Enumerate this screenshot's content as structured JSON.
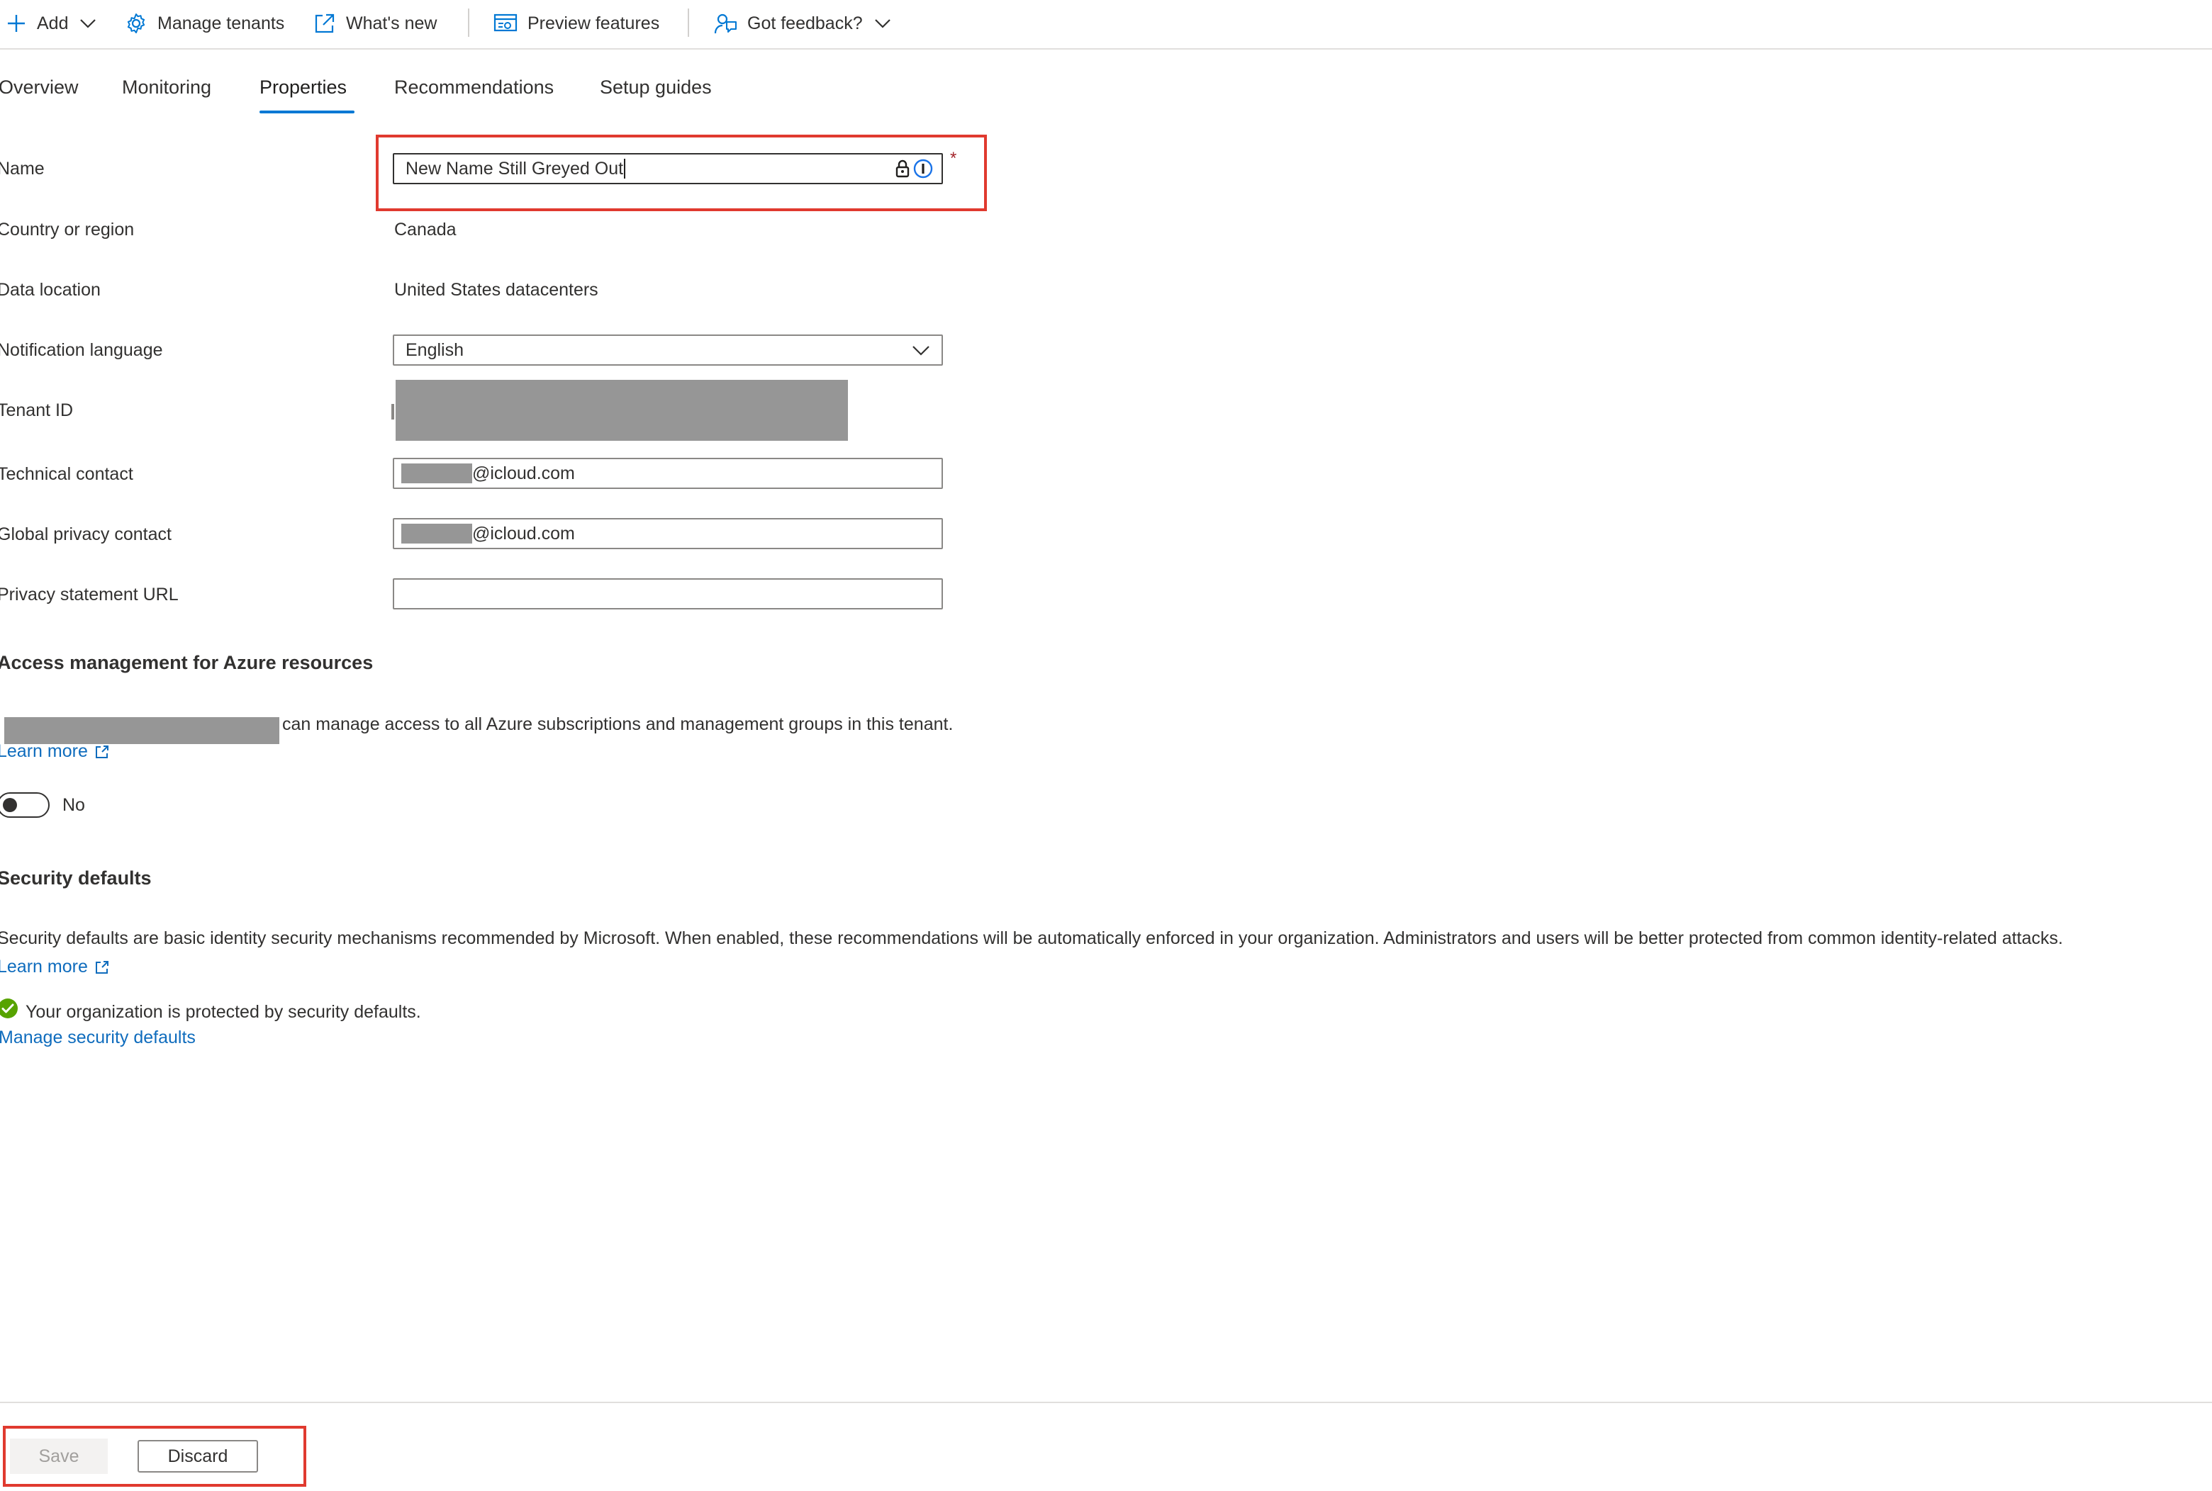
{
  "toolbar": {
    "add_label": "Add",
    "manage_tenants_label": "Manage tenants",
    "whats_new_label": "What's new",
    "preview_features_label": "Preview features",
    "feedback_label": "Got feedback?"
  },
  "tabs": [
    {
      "label": "Overview",
      "active": false
    },
    {
      "label": "Monitoring",
      "active": false
    },
    {
      "label": "Properties",
      "active": true
    },
    {
      "label": "Recommendations",
      "active": false
    },
    {
      "label": "Setup guides",
      "active": false
    }
  ],
  "form": {
    "name_label": "Name",
    "name_value": "New Name Still Greyed Out",
    "required_marker": "*",
    "country_label": "Country or region",
    "country_value": "Canada",
    "data_location_label": "Data location",
    "data_location_value": "United States datacenters",
    "notification_language_label": "Notification language",
    "notification_language_value": "English",
    "tenant_id_label": "Tenant ID",
    "technical_contact_label": "Technical contact",
    "technical_contact_domain": "@icloud.com",
    "privacy_contact_label": "Global privacy contact",
    "privacy_contact_domain": "@icloud.com",
    "privacy_url_label": "Privacy statement URL",
    "privacy_url_value": ""
  },
  "access": {
    "heading": "Access management for Azure resources",
    "description": "can manage access to all Azure subscriptions and management groups in this tenant.",
    "learn_more": "Learn more",
    "toggle_label": "No",
    "toggle_on": false
  },
  "security": {
    "heading": "Security defaults",
    "description": "Security defaults are basic identity security mechanisms recommended by Microsoft. When enabled, these recommendations will be automatically enforced in your organization. Administrators and users will be better protected from common identity-related attacks.",
    "learn_more": "Learn more",
    "status": "Your organization is protected by security defaults.",
    "manage_link": "Manage security defaults"
  },
  "footer": {
    "save_label": "Save",
    "discard_label": "Discard"
  },
  "colors": {
    "accent": "#0078d4",
    "link": "#0f6cbd",
    "highlight": "#e03a2f",
    "success": "#57a300"
  }
}
